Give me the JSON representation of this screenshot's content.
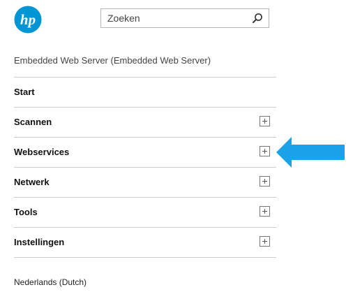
{
  "header": {
    "logo_text": "hp",
    "search": {
      "placeholder": "Zoeken",
      "icon": "search-icon"
    }
  },
  "page": {
    "subtitle": "Embedded Web Server (Embedded Web Server)"
  },
  "nav": {
    "items": [
      {
        "label": "Start",
        "expandable": false
      },
      {
        "label": "Scannen",
        "expandable": true,
        "icon": "expand-plus-icon"
      },
      {
        "label": "Webservices",
        "expandable": true,
        "icon": "expand-plus-icon"
      },
      {
        "label": "Netwerk",
        "expandable": true,
        "icon": "expand-plus-icon"
      },
      {
        "label": "Tools",
        "expandable": true,
        "icon": "expand-plus-icon"
      },
      {
        "label": "Instellingen",
        "expandable": true,
        "icon": "expand-plus-icon"
      }
    ]
  },
  "annotation": {
    "icon": "pointer-arrow-icon",
    "color": "#1aa3e8",
    "points_to": "Webservices"
  },
  "footer": {
    "language": "Nederlands (Dutch)"
  },
  "colors": {
    "logo_blue": "#0096d6",
    "divider": "#cccccc"
  }
}
